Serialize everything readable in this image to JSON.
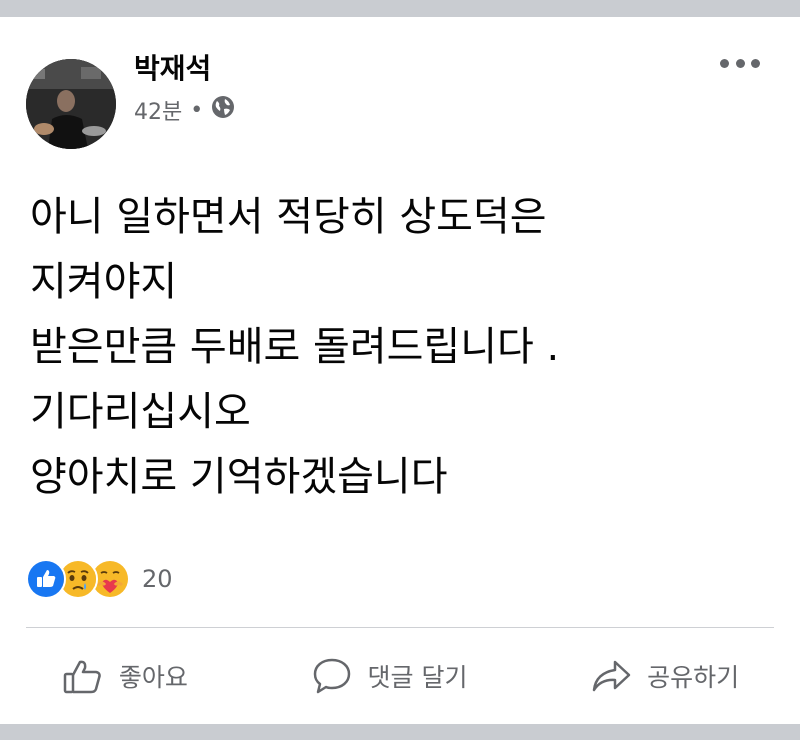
{
  "post": {
    "author": "박재석",
    "time": "42분",
    "separator": "•",
    "privacy_icon": "globe-icon",
    "text_lines": [
      "아니 일하면서 적당히 상도덕은",
      "지켜야지",
      "받은만큼 두배로 돌려드립니다 .",
      "기다리십시오",
      "양아치로 기억하겠습니다"
    ]
  },
  "reactions": {
    "icons": [
      "like-icon",
      "sad-icon",
      "care-icon"
    ],
    "count": "20"
  },
  "actions": {
    "like_label": "좋아요",
    "comment_label": "댓글 달기",
    "share_label": "공유하기"
  },
  "colors": {
    "text": "#050505",
    "secondary": "#65676b",
    "like_blue": "#1877f2",
    "reaction_yellow": "#f7b928",
    "background": "#c9ccd1"
  }
}
